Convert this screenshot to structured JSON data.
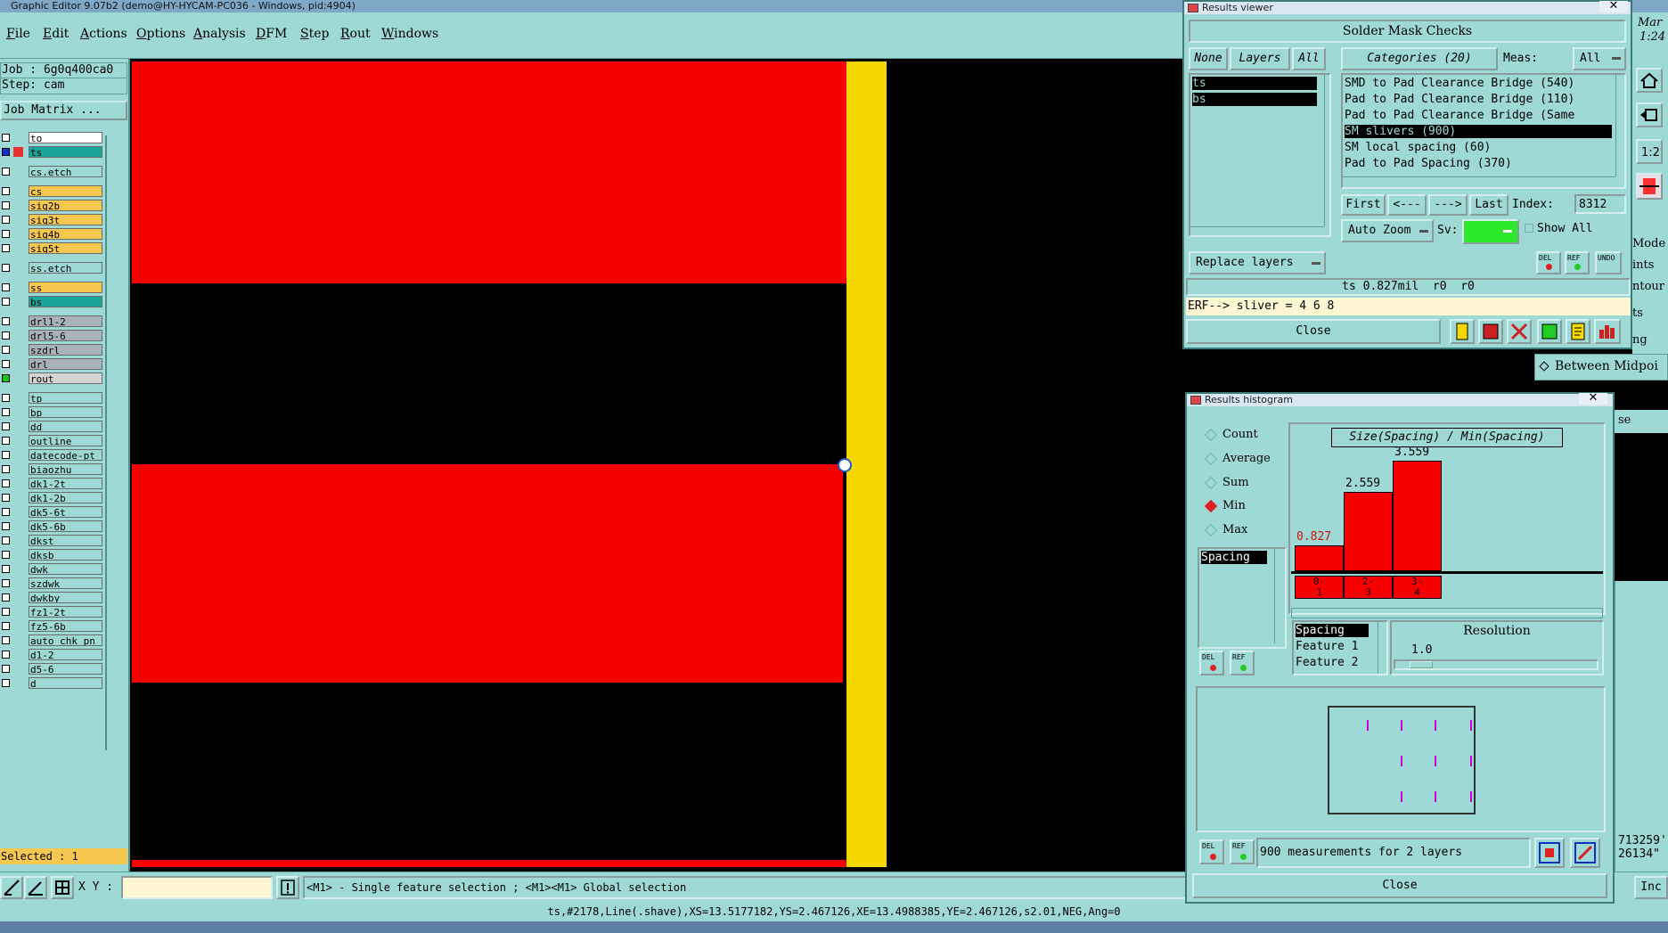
{
  "app": {
    "window_title": "Graphic Editor 9.07b2 (demo@HY-HYCAM-PC036 - Windows, pid:4904)"
  },
  "menu": [
    "File",
    "Edit",
    "Actions",
    "Options",
    "Analysis",
    "DFM",
    "Step",
    "Rout",
    "Windows"
  ],
  "job": {
    "job_line": "Job : 6g0q400ca0",
    "step_line": "Step: cam",
    "matrix_button": "Job Matrix ..."
  },
  "layers": [
    {
      "name": "to",
      "color": "#ffffff",
      "state": "off"
    },
    {
      "name": "ts",
      "color": "#1aa59a",
      "state": "work"
    },
    {
      "name": "cs.etch",
      "color": "#9ed9d6",
      "state": "off"
    },
    {
      "name": "cs",
      "color": "#f7c850",
      "state": "off"
    },
    {
      "name": "sig2b",
      "color": "#f7c850",
      "state": "off"
    },
    {
      "name": "sig3t",
      "color": "#f7c850",
      "state": "off"
    },
    {
      "name": "sig4b",
      "color": "#f7c850",
      "state": "off"
    },
    {
      "name": "sig5t",
      "color": "#f7c850",
      "state": "off"
    },
    {
      "name": "ss.etch",
      "color": "#9ed9d6",
      "state": "off"
    },
    {
      "name": "ss",
      "color": "#f7c850",
      "state": "off"
    },
    {
      "name": "bs",
      "color": "#1aa59a",
      "state": "off"
    },
    {
      "name": "drl1-2",
      "color": "#a9b2b8",
      "state": "off"
    },
    {
      "name": "drl5-6",
      "color": "#a9b2b8",
      "state": "off"
    },
    {
      "name": "szdrl",
      "color": "#a9b2b8",
      "state": "off"
    },
    {
      "name": "drl",
      "color": "#a9b2b8",
      "state": "off"
    },
    {
      "name": "rout",
      "color": "#d4d4d4",
      "state": "green"
    },
    {
      "name": "tp",
      "color": "#9ed9d6",
      "state": "off"
    },
    {
      "name": "bp",
      "color": "#9ed9d6",
      "state": "off"
    },
    {
      "name": "dd",
      "color": "#9ed9d6",
      "state": "off"
    },
    {
      "name": "outline",
      "color": "#9ed9d6",
      "state": "off"
    },
    {
      "name": "datecode-pt",
      "color": "#9ed9d6",
      "state": "off"
    },
    {
      "name": "biaozhu",
      "color": "#9ed9d6",
      "state": "off"
    },
    {
      "name": "dk1-2t",
      "color": "#9ed9d6",
      "state": "off"
    },
    {
      "name": "dk1-2b",
      "color": "#9ed9d6",
      "state": "off"
    },
    {
      "name": "dk5-6t",
      "color": "#9ed9d6",
      "state": "off"
    },
    {
      "name": "dk5-6b",
      "color": "#9ed9d6",
      "state": "off"
    },
    {
      "name": "dkst",
      "color": "#9ed9d6",
      "state": "off"
    },
    {
      "name": "dksb",
      "color": "#9ed9d6",
      "state": "off"
    },
    {
      "name": "dwk",
      "color": "#9ed9d6",
      "state": "off"
    },
    {
      "name": "szdwk",
      "color": "#9ed9d6",
      "state": "off"
    },
    {
      "name": "dwkby",
      "color": "#9ed9d6",
      "state": "off"
    },
    {
      "name": "fz1-2t",
      "color": "#9ed9d6",
      "state": "off"
    },
    {
      "name": "fz5-6b",
      "color": "#9ed9d6",
      "state": "off"
    },
    {
      "name": "auto_chk_pn",
      "color": "#9ed9d6",
      "state": "off"
    },
    {
      "name": "d1-2",
      "color": "#9ed9d6",
      "state": "off"
    },
    {
      "name": "d5-6",
      "color": "#9ed9d6",
      "state": "off"
    },
    {
      "name": "d",
      "color": "#9ed9d6",
      "state": "off"
    }
  ],
  "selected_text": "Selected : 1",
  "bottom": {
    "xy_label": "X Y :",
    "xy_value": "",
    "hint": "<M1> - Single feature selection ; <M1><M1> Global selection",
    "status": "ts,#2178,Line(.shave),XS=13.5177182,YS=2.467126,XE=13.4988385,YE=2.467126,s2.01,NEG,Ang=0"
  },
  "right_strip": {
    "date_top": "Mar",
    "time_top": "1:24",
    "labels": [
      "Mode",
      "ints",
      "ntour",
      "ts",
      "ng"
    ],
    "between_midpoints": "Between Midpoi",
    "se": "se",
    "coords": [
      "713259'",
      "26134\""
    ],
    "inc_button": "Inc"
  },
  "results_viewer": {
    "title": "Results viewer",
    "header": "Solder Mask Checks",
    "none_btn": "None",
    "layers_btn": "Layers",
    "all_btn": "All",
    "categories_btn": "Categories (20)",
    "meas_label": "Meas:",
    "meas_value": "All",
    "layers": [
      "ts",
      "bs"
    ],
    "categories": [
      "SMD to Pad Clearance Bridge (540)",
      "Pad to Pad Clearance Bridge (110)",
      "Pad to Pad Clearance Bridge (Same",
      "SM slivers (900)",
      "SM local spacing (60)",
      "Pad to Pad Spacing (370)"
    ],
    "selected_category_index": 3,
    "first": "First",
    "prev": "<---",
    "next": "--->",
    "last": "Last",
    "index_label": "Index:",
    "index_value": "8312",
    "auto_zoom": "Auto Zoom",
    "sv_label": "Sv:",
    "show_all": "Show All",
    "replace_layers": "Replace layers",
    "small_btns": [
      "DEL",
      "REF",
      "UNDO"
    ],
    "info_line": "ts 0.827mil  r0  r0",
    "erf_line": "ERF--> sliver = 4 6 8",
    "close": "Close"
  },
  "histogram": {
    "title": "Results histogram",
    "chart_title": "Size(Spacing) / Min(Spacing)",
    "modes": [
      "Count",
      "Average",
      "Sum",
      "Min",
      "Max"
    ],
    "selected_mode": "Min",
    "list_item": "Spacing",
    "bin_labels": [
      [
        "0-",
        "1"
      ],
      [
        "2-",
        "3"
      ],
      [
        "3-",
        "4"
      ]
    ],
    "fields": [
      "Spacing",
      "Feature 1",
      "Feature 2"
    ],
    "resolution_label": "Resolution",
    "resolution_value": "1.0",
    "summary": "900 measurements for 2 layers",
    "small_btns": [
      "DEL",
      "REF"
    ],
    "close": "Close"
  },
  "chart_data": {
    "type": "bar",
    "title": "Size(Spacing) / Min(Spacing)",
    "categories": [
      "0-1",
      "2-3",
      "3-4"
    ],
    "values": [
      0.827,
      2.559,
      3.559
    ],
    "ylim": [
      0,
      3.559
    ]
  }
}
